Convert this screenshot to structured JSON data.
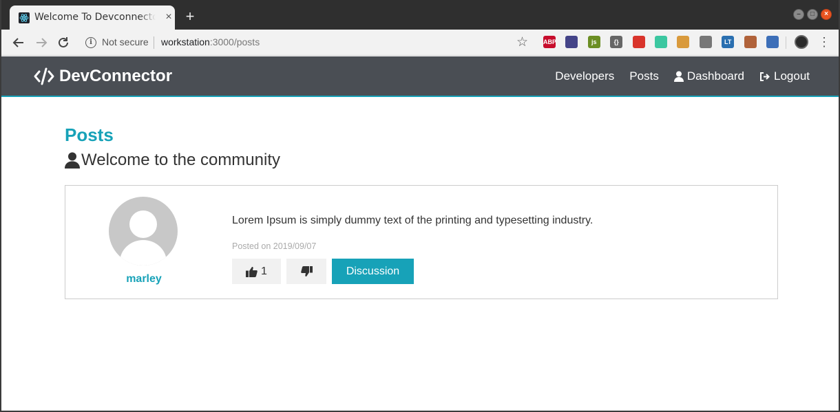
{
  "browser": {
    "tab_title": "Welcome To Devconnector",
    "tab_close": "×",
    "new_tab": "+",
    "security_label": "Not secure",
    "url_host": "workstation",
    "url_rest": ":3000/posts",
    "extensions": [
      {
        "name": "adblock-plus-icon",
        "label": "ABP",
        "color": "#c70d2c"
      },
      {
        "name": "colorzilla-icon",
        "label": "",
        "color": "#444488"
      },
      {
        "name": "js-icon",
        "label": "js",
        "color": "#6b8e23"
      },
      {
        "name": "json-viewer-icon",
        "label": "{}",
        "color": "#666666"
      },
      {
        "name": "extension-red-icon",
        "label": "",
        "color": "#d9342b"
      },
      {
        "name": "extension-target-icon",
        "label": "",
        "color": "#3cc7a0"
      },
      {
        "name": "cookie-icon",
        "label": "",
        "color": "#d99a3c"
      },
      {
        "name": "extension-bike-icon",
        "label": "",
        "color": "#777777"
      },
      {
        "name": "languagetool-icon",
        "label": "LT",
        "color": "#2a6fb0"
      },
      {
        "name": "extension-monkey-icon",
        "label": "",
        "color": "#b0623a"
      },
      {
        "name": "save-icon",
        "label": "",
        "color": "#3d6fb8"
      }
    ]
  },
  "navbar": {
    "brand": "DevConnector",
    "links": {
      "developers": "Developers",
      "posts": "Posts",
      "dashboard": "Dashboard",
      "logout": "Logout"
    }
  },
  "page": {
    "heading": "Posts",
    "lead": "Welcome to the community"
  },
  "post": {
    "user": "marley",
    "text": "Lorem Ipsum is simply dummy text of the printing and typesetting industry.",
    "date": "Posted on 2019/09/07",
    "likes": "1",
    "discussion_label": "Discussion"
  },
  "colors": {
    "primary": "#17a2b8",
    "navbar": "#4a4e54"
  }
}
